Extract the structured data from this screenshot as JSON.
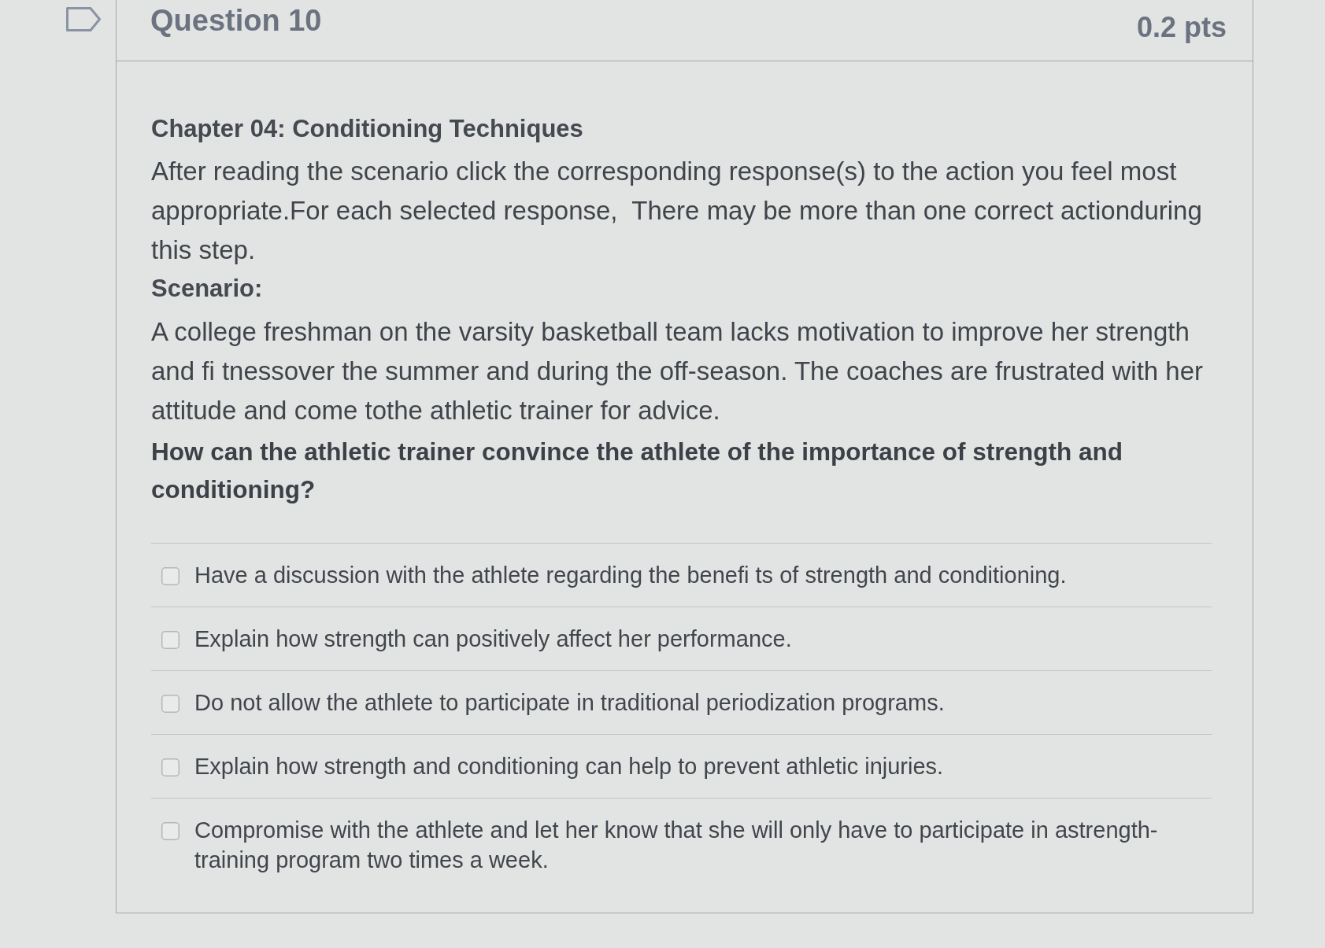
{
  "question": {
    "flagged": false,
    "title": "Question 10",
    "points": "0.2 pts",
    "chapter": "Chapter 04: Conditioning Techniques",
    "instructions": "After reading the scenario click the corresponding response(s) to the action you feel most appropriate.For each selected response,  There may be more than one correct actionduring this step.",
    "scenario_label": "Scenario:",
    "scenario": "A college freshman on the varsity basketball team lacks motivation to improve her strength and fi tnessover the summer and during the off-season. The coaches are frustrated with her attitude and come tothe athletic trainer for advice.",
    "prompt": "How can the athletic trainer convince the athlete of the importance of strength and conditioning?",
    "options": [
      {
        "label": "Have a discussion with the athlete regarding the benefi ts of strength and conditioning.",
        "checked": false
      },
      {
        "label": "Explain how strength can positively affect her performance.",
        "checked": false
      },
      {
        "label": "Do not allow the athlete to participate in traditional periodization programs.",
        "checked": false
      },
      {
        "label": "Explain how strength and conditioning can help to prevent athletic injuries.",
        "checked": false
      },
      {
        "label": "Compromise with the athlete and let her know that she will only have to participate in astrength-training program two times a week.",
        "checked": false
      }
    ]
  }
}
